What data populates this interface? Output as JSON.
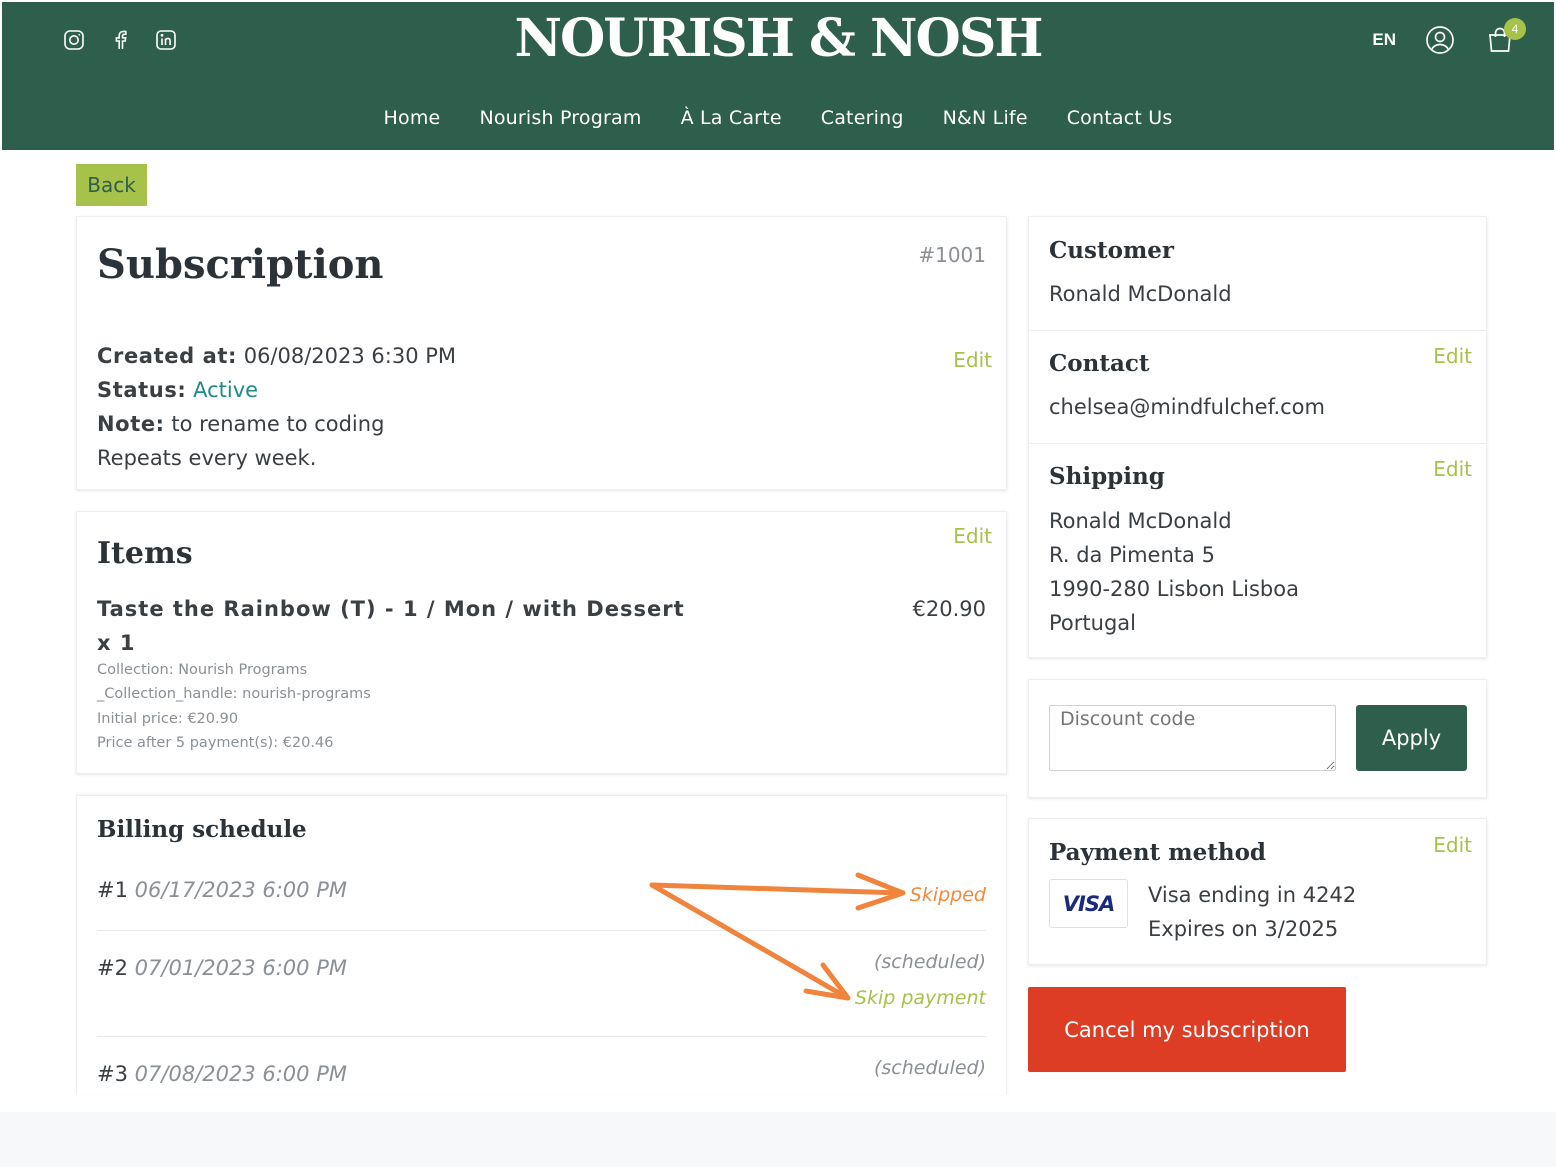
{
  "header": {
    "logo": "NOURISH & NOSH",
    "language": "EN",
    "cart_count": "4",
    "nav": [
      "Home",
      "Nourish Program",
      "À La Carte",
      "Catering",
      "N&N Life",
      "Contact Us"
    ]
  },
  "back_label": "Back",
  "subscription": {
    "title": "Subscription",
    "id": "#1001",
    "edit_label": "Edit",
    "created_label": "Created at:",
    "created_value": "06/08/2023 6:30 PM",
    "status_label": "Status:",
    "status_value": "Active",
    "note_label": "Note:",
    "note_value": "to rename to coding",
    "repeat_text": "Repeats every week."
  },
  "items": {
    "title": "Items",
    "edit_label": "Edit",
    "list": [
      {
        "name_line1": "Taste the Rainbow (T) - 1 / Mon / with Dessert",
        "name_line2": "x 1",
        "price": "€20.90",
        "meta": [
          "Collection: Nourish Programs",
          "_Collection_handle: nourish-programs",
          "Initial price: €20.90",
          "Price after 5 payment(s): €20.46"
        ]
      }
    ]
  },
  "billing": {
    "title": "Billing schedule",
    "rows": [
      {
        "num": "#1",
        "date": "06/17/2023 6:00 PM",
        "status": "Skipped",
        "action": ""
      },
      {
        "num": "#2",
        "date": "07/01/2023 6:00 PM",
        "status": "(scheduled)",
        "action": "Skip payment"
      },
      {
        "num": "#3",
        "date": "07/08/2023 6:00 PM",
        "status": "(scheduled)",
        "action": ""
      }
    ]
  },
  "customer": {
    "title": "Customer",
    "name": "Ronald McDonald"
  },
  "contact": {
    "title": "Contact",
    "email": "chelsea@mindfulchef.com",
    "edit_label": "Edit"
  },
  "shipping": {
    "title": "Shipping",
    "edit_label": "Edit",
    "lines": [
      "Ronald McDonald",
      "R. da Pimenta 5",
      "1990-280 Lisbon Lisboa",
      "Portugal"
    ]
  },
  "discount": {
    "placeholder": "Discount code",
    "apply_label": "Apply"
  },
  "payment": {
    "title": "Payment method",
    "edit_label": "Edit",
    "card_brand": "VISA",
    "card_line": "Visa ending in 4242",
    "expiry_line": "Expires on 3/2025"
  },
  "cancel_label": "Cancel my subscription",
  "colors": {
    "header_bg": "#2e5f4c",
    "accent_green": "#a6c24a",
    "active_teal": "#1f8a8a",
    "skipped_orange": "#f08a3c",
    "cancel_red": "#dd3c25"
  }
}
